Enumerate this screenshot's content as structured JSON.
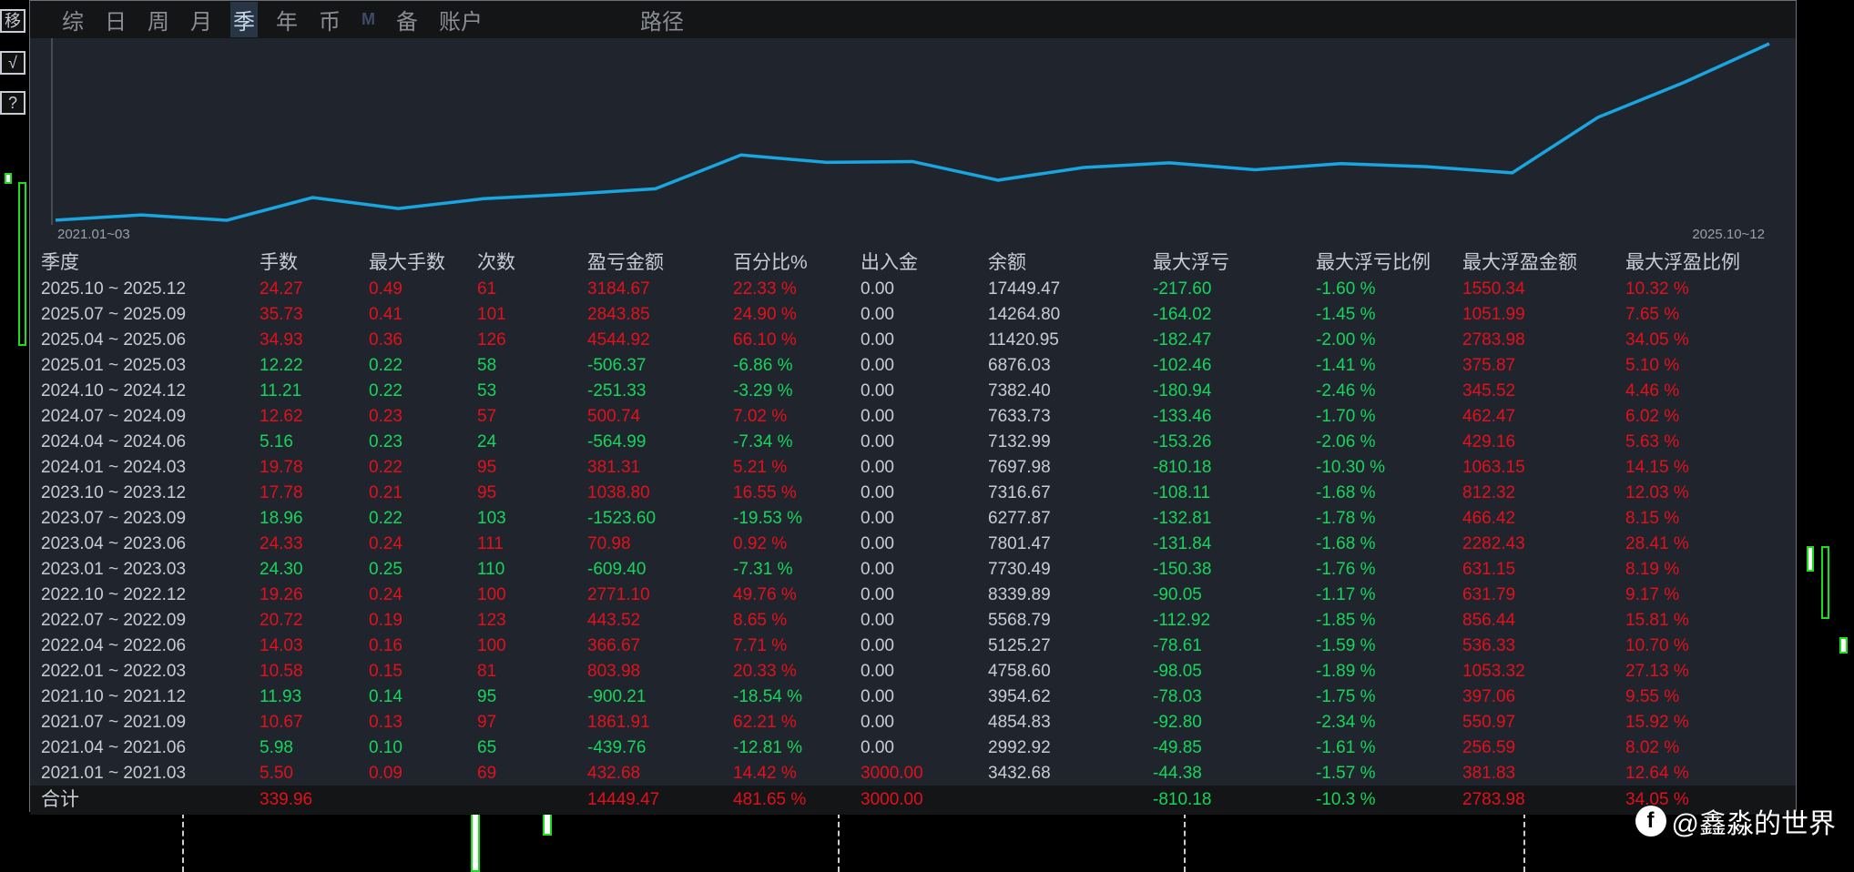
{
  "side_buttons": [
    "移",
    "√",
    "?"
  ],
  "tabs": [
    {
      "label": "综"
    },
    {
      "label": "日"
    },
    {
      "label": "周"
    },
    {
      "label": "月"
    },
    {
      "label": "季",
      "active": true
    },
    {
      "label": "年"
    },
    {
      "label": "币"
    },
    {
      "label": "M"
    },
    {
      "label": "备"
    },
    {
      "label": "账户"
    }
  ],
  "path_tab": "路径",
  "chart_data": {
    "type": "line",
    "x_start_label": "2021.01~03",
    "x_end_label": "2025.10~12",
    "series": [
      {
        "name": "余额",
        "values": [
          3000,
          3432.68,
          2992.92,
          4854.83,
          3954.62,
          4758.6,
          5125.27,
          5568.79,
          8339.89,
          7730.49,
          7801.47,
          6277.87,
          7316.67,
          7697.98,
          7132.99,
          7633.73,
          7382.4,
          6876.03,
          11420.95,
          14264.8,
          17449.47
        ]
      }
    ],
    "color": "#19a6e0"
  },
  "table": {
    "headers": [
      "季度",
      "手数",
      "最大手数",
      "次数",
      "盈亏金额",
      "百分比%",
      "出入金",
      "余额",
      "最大浮亏",
      "最大浮亏比例",
      "最大浮盈金额",
      "最大浮盈比例"
    ],
    "rows": [
      [
        "2025.10 ~ 2025.12",
        "24.27",
        "0.49",
        "61",
        "3184.67",
        "22.33 %",
        "0.00",
        "17449.47",
        "-217.60",
        "-1.60 %",
        "1550.34",
        "10.32 %"
      ],
      [
        "2025.07 ~ 2025.09",
        "35.73",
        "0.41",
        "101",
        "2843.85",
        "24.90 %",
        "0.00",
        "14264.80",
        "-164.02",
        "-1.45 %",
        "1051.99",
        "7.65 %"
      ],
      [
        "2025.04 ~ 2025.06",
        "34.93",
        "0.36",
        "126",
        "4544.92",
        "66.10 %",
        "0.00",
        "11420.95",
        "-182.47",
        "-2.00 %",
        "2783.98",
        "34.05 %"
      ],
      [
        "2025.01 ~ 2025.03",
        "12.22",
        "0.22",
        "58",
        "-506.37",
        "-6.86 %",
        "0.00",
        "6876.03",
        "-102.46",
        "-1.41 %",
        "375.87",
        "5.10 %"
      ],
      [
        "2024.10 ~ 2024.12",
        "11.21",
        "0.22",
        "53",
        "-251.33",
        "-3.29 %",
        "0.00",
        "7382.40",
        "-180.94",
        "-2.46 %",
        "345.52",
        "4.46 %"
      ],
      [
        "2024.07 ~ 2024.09",
        "12.62",
        "0.23",
        "57",
        "500.74",
        "7.02 %",
        "0.00",
        "7633.73",
        "-133.46",
        "-1.70 %",
        "462.47",
        "6.02 %"
      ],
      [
        "2024.04 ~ 2024.06",
        "5.16",
        "0.23",
        "24",
        "-564.99",
        "-7.34 %",
        "0.00",
        "7132.99",
        "-153.26",
        "-2.06 %",
        "429.16",
        "5.63 %"
      ],
      [
        "2024.01 ~ 2024.03",
        "19.78",
        "0.22",
        "95",
        "381.31",
        "5.21 %",
        "0.00",
        "7697.98",
        "-810.18",
        "-10.30 %",
        "1063.15",
        "14.15 %"
      ],
      [
        "2023.10 ~ 2023.12",
        "17.78",
        "0.21",
        "95",
        "1038.80",
        "16.55 %",
        "0.00",
        "7316.67",
        "-108.11",
        "-1.68 %",
        "812.32",
        "12.03 %"
      ],
      [
        "2023.07 ~ 2023.09",
        "18.96",
        "0.22",
        "103",
        "-1523.60",
        "-19.53 %",
        "0.00",
        "6277.87",
        "-132.81",
        "-1.78 %",
        "466.42",
        "8.15 %"
      ],
      [
        "2023.04 ~ 2023.06",
        "24.33",
        "0.24",
        "111",
        "70.98",
        "0.92 %",
        "0.00",
        "7801.47",
        "-131.84",
        "-1.68 %",
        "2282.43",
        "28.41 %"
      ],
      [
        "2023.01 ~ 2023.03",
        "24.30",
        "0.25",
        "110",
        "-609.40",
        "-7.31 %",
        "0.00",
        "7730.49",
        "-150.38",
        "-1.76 %",
        "631.15",
        "8.19 %"
      ],
      [
        "2022.10 ~ 2022.12",
        "19.26",
        "0.24",
        "100",
        "2771.10",
        "49.76 %",
        "0.00",
        "8339.89",
        "-90.05",
        "-1.17 %",
        "631.79",
        "9.17 %"
      ],
      [
        "2022.07 ~ 2022.09",
        "20.72",
        "0.19",
        "123",
        "443.52",
        "8.65 %",
        "0.00",
        "5568.79",
        "-112.92",
        "-1.85 %",
        "856.44",
        "15.81 %"
      ],
      [
        "2022.04 ~ 2022.06",
        "14.03",
        "0.16",
        "100",
        "366.67",
        "7.71 %",
        "0.00",
        "5125.27",
        "-78.61",
        "-1.59 %",
        "536.33",
        "10.70 %"
      ],
      [
        "2022.01 ~ 2022.03",
        "10.58",
        "0.15",
        "81",
        "803.98",
        "20.33 %",
        "0.00",
        "4758.60",
        "-98.05",
        "-1.89 %",
        "1053.32",
        "27.13 %"
      ],
      [
        "2021.10 ~ 2021.12",
        "11.93",
        "0.14",
        "95",
        "-900.21",
        "-18.54 %",
        "0.00",
        "3954.62",
        "-78.03",
        "-1.75 %",
        "397.06",
        "9.55 %"
      ],
      [
        "2021.07 ~ 2021.09",
        "10.67",
        "0.13",
        "97",
        "1861.91",
        "62.21 %",
        "0.00",
        "4854.83",
        "-92.80",
        "-2.34 %",
        "550.97",
        "15.92 %"
      ],
      [
        "2021.04 ~ 2021.06",
        "5.98",
        "0.10",
        "65",
        "-439.76",
        "-12.81 %",
        "0.00",
        "2992.92",
        "-49.85",
        "-1.61 %",
        "256.59",
        "8.02 %"
      ],
      [
        "2021.01 ~ 2021.03",
        "5.50",
        "0.09",
        "69",
        "432.68",
        "14.42 %",
        "3000.00",
        "3432.68",
        "-44.38",
        "-1.57 %",
        "381.83",
        "12.64 %"
      ]
    ],
    "totals": [
      "合计",
      "339.96",
      "",
      "",
      "14449.47",
      "481.65 %",
      "3000.00",
      "",
      "-810.18",
      "-10.3 %",
      "2783.98",
      "34.05 %"
    ]
  },
  "colors": {
    "red": "#e3101c",
    "green": "#16d45c",
    "gray": "#c8ccd4"
  },
  "watermark": "@鑫淼的世界"
}
